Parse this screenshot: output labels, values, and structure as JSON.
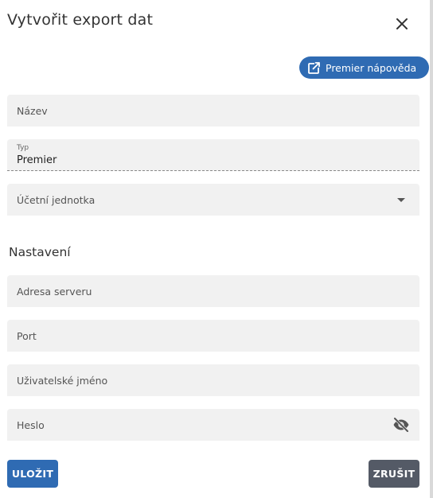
{
  "dialog": {
    "title": "Vytvořit export dat",
    "help_button": "Premier nápověda"
  },
  "form": {
    "name_label": "Název",
    "type_label": "Typ",
    "type_value": "Premier",
    "unit_label": "Účetní jednotka"
  },
  "settings": {
    "heading": "Nastavení",
    "server_label": "Adresa serveru",
    "port_label": "Port",
    "username_label": "Uživatelské jméno",
    "password_label": "Heslo"
  },
  "actions": {
    "save": "ULOŽIT",
    "cancel": "ZRUŠIT"
  },
  "colors": {
    "primary": "#2f6bb3",
    "secondary": "#545a66",
    "field_bg": "#f1f1f1"
  },
  "icons": {
    "close": "close-icon",
    "help": "open-in-new-icon",
    "dropdown": "caret-down-icon",
    "password_toggle": "eye-off-icon"
  }
}
